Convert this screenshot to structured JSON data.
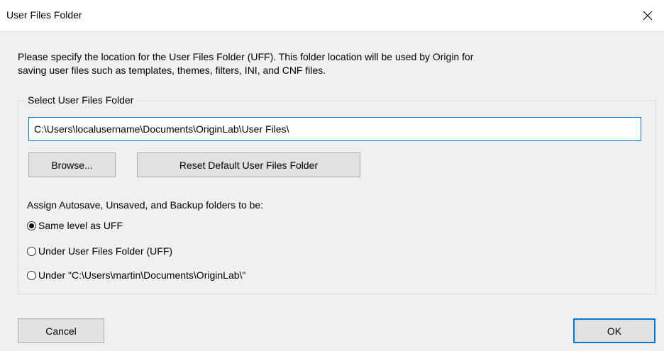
{
  "window": {
    "title": "User Files Folder",
    "close_icon": "close-icon"
  },
  "description": {
    "line1": "Please specify the location for the User Files Folder (UFF). This folder location will be used by Origin for",
    "line2": "saving user files such as templates, themes, filters, INI, and CNF files."
  },
  "select_group": {
    "title": "Select User Files Folder",
    "path_value": "C:\\Users\\localusername\\Documents\\OriginLab\\User Files\\",
    "browse_label": "Browse...",
    "reset_label": "Reset Default User Files Folder"
  },
  "assign": {
    "label": "Assign Autosave, Unsaved, and Backup folders to be:",
    "options": [
      {
        "label": "Same level as UFF",
        "selected": true
      },
      {
        "label": "Under User Files Folder (UFF)",
        "selected": false
      },
      {
        "label": "Under \"C:\\Users\\martin\\Documents\\OriginLab\\\"",
        "selected": false
      }
    ]
  },
  "footer": {
    "cancel_label": "Cancel",
    "ok_label": "OK"
  },
  "colors": {
    "accent": "#0078d7",
    "dialog_bg": "#f0f0f0",
    "button_bg": "#e1e1e1"
  }
}
